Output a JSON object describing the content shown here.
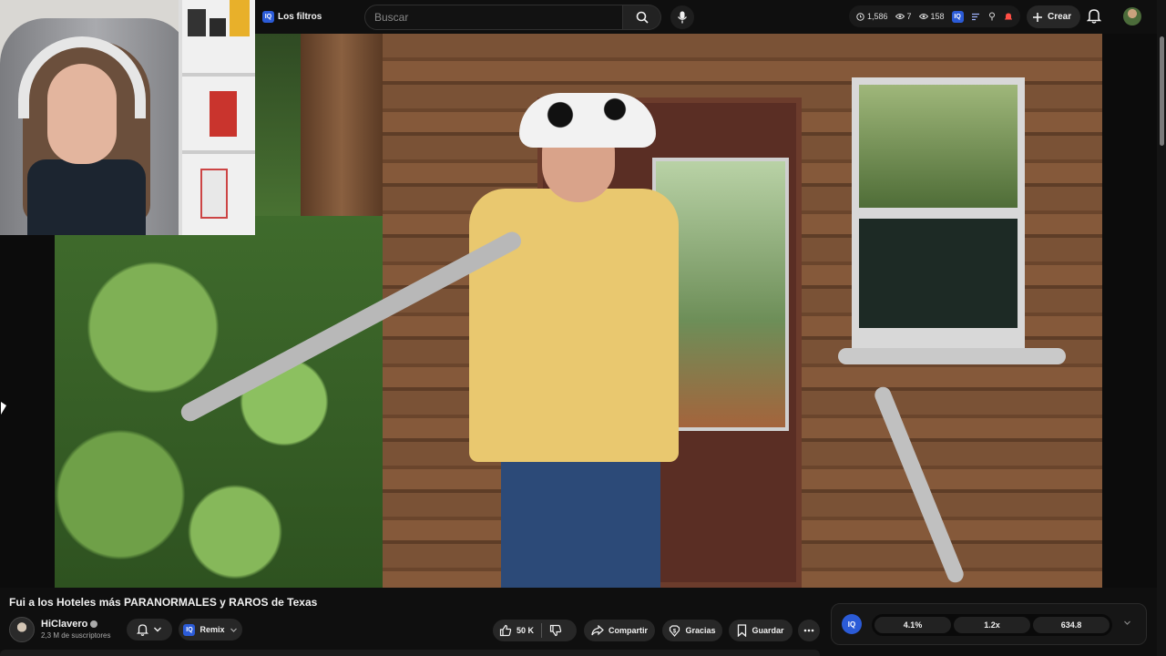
{
  "masthead": {
    "filters_label": "Los filtros",
    "iq_badge": "IQ",
    "search_placeholder": "Buscar",
    "stats": {
      "time_count": "1,586",
      "view_count_a": "7",
      "view_count_b": "158"
    },
    "create_label": "Crear"
  },
  "video": {
    "title": "Fui a los Hoteles más PARANORMALES y RAROS de Texas"
  },
  "channel": {
    "name": "HiClavero",
    "subscribers": "2,3 M de suscriptores"
  },
  "actions": {
    "remix_label": "Remix",
    "like_count": "50 K",
    "share_label": "Compartir",
    "thanks_label": "Gracias",
    "save_label": "Guardar"
  },
  "iq_panel": {
    "badge": "IQ",
    "metrics": [
      "4.1%",
      "1.2x",
      "634.8"
    ]
  },
  "colors": {
    "background": "#0f0f0f",
    "pill": "#272727",
    "accent": "#2b5bd7",
    "notif_red": "#ff4e45"
  }
}
